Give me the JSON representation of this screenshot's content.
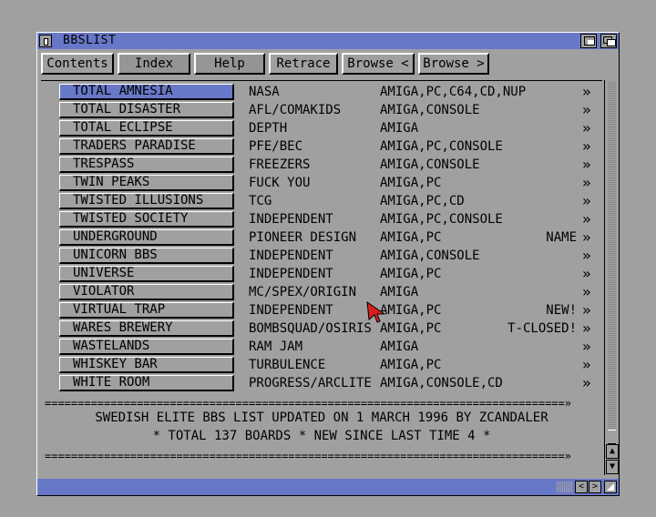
{
  "window": {
    "title": "BBSLIST"
  },
  "colors": {
    "accent": "#6878c8",
    "panel": "#a0a0a0",
    "cursor": "#d82020"
  },
  "toolbar": [
    {
      "label": "Contents",
      "enabled": true
    },
    {
      "label": "Index",
      "enabled": false
    },
    {
      "label": "Help",
      "enabled": false
    },
    {
      "label": "Retrace",
      "enabled": true
    },
    {
      "label": "Browse <",
      "enabled": true
    },
    {
      "label": "Browse >",
      "enabled": true
    }
  ],
  "list": {
    "rows": [
      {
        "name": "TOTAL AMNESIA",
        "group": "NASA",
        "systems": "AMIGA,PC,C64,CD,NUP",
        "note": "",
        "more": "»",
        "selected": true
      },
      {
        "name": "TOTAL DISASTER",
        "group": "AFL/COMAKIDS",
        "systems": "AMIGA,CONSOLE",
        "note": "",
        "more": "»"
      },
      {
        "name": "TOTAL ECLIPSE",
        "group": "DEPTH",
        "systems": "AMIGA",
        "note": "",
        "more": "»"
      },
      {
        "name": "TRADERS PARADISE",
        "group": "PFE/BEC",
        "systems": "AMIGA,PC,CONSOLE",
        "note": "",
        "more": "»"
      },
      {
        "name": "TRESPASS",
        "group": "FREEZERS",
        "systems": "AMIGA,CONSOLE",
        "note": "",
        "more": "»"
      },
      {
        "name": "TWIN PEAKS",
        "group": "FUCK YOU",
        "systems": "AMIGA,PC",
        "note": "",
        "more": "»"
      },
      {
        "name": "TWISTED ILLUSIONS",
        "group": "TCG",
        "systems": "AMIGA,PC,CD",
        "note": "",
        "more": "»"
      },
      {
        "name": "TWISTED SOCIETY",
        "group": "INDEPENDENT",
        "systems": "AMIGA,PC,CONSOLE",
        "note": "",
        "more": "»"
      },
      {
        "name": "UNDERGROUND",
        "group": "PIONEER DESIGN",
        "systems": "AMIGA,PC",
        "note": "NAME",
        "more": "»"
      },
      {
        "name": "UNICORN BBS",
        "group": "INDEPENDENT",
        "systems": "AMIGA,CONSOLE",
        "note": "",
        "more": "»"
      },
      {
        "name": "UNIVERSE",
        "group": "INDEPENDENT",
        "systems": "AMIGA,PC",
        "note": "",
        "more": "»"
      },
      {
        "name": "VIOLATOR",
        "group": "MC/SPEX/ORIGIN",
        "systems": "AMIGA",
        "note": "",
        "more": "»"
      },
      {
        "name": "VIRTUAL TRAP",
        "group": "INDEPENDENT",
        "systems": "AMIGA,PC",
        "note": "NEW!",
        "more": "»"
      },
      {
        "name": "WARES BREWERY",
        "group": "BOMBSQUAD/OSIRIS",
        "systems": "AMIGA,PC",
        "note": "T-CLOSED!",
        "more": "»"
      },
      {
        "name": "WASTELANDS",
        "group": "RAM JAM",
        "systems": "AMIGA",
        "note": "",
        "more": "»"
      },
      {
        "name": "WHISKEY BAR",
        "group": "TURBULENCE",
        "systems": "AMIGA,PC",
        "note": "",
        "more": "»"
      },
      {
        "name": "WHITE ROOM",
        "group": "PROGRESS/ARCLITE",
        "systems": "AMIGA,CONSOLE,CD",
        "note": "",
        "more": "»"
      }
    ]
  },
  "footer": {
    "separator": "===============================================================================»",
    "line1": "SWEDISH ELITE BBS LIST UPDATED ON 1 MARCH 1996 BY ZCANDALER",
    "line2": "* TOTAL 137 BOARDS * NEW SINCE LAST TIME 4 *"
  },
  "scrollbars": {
    "up_arrow": "▲",
    "down_arrow": "▼",
    "left_arrow": "<",
    "right_arrow": ">"
  }
}
